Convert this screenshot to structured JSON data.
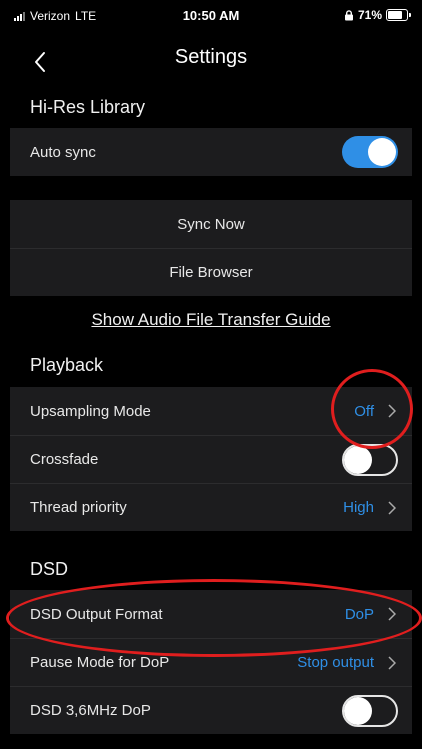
{
  "status_bar": {
    "carrier": "Verizon",
    "network": "LTE",
    "time": "10:50 AM",
    "battery": "71%"
  },
  "nav": {
    "title": "Settings",
    "back_icon": "chevron-left-icon"
  },
  "hires_library": {
    "header": "Hi-Res Library",
    "auto_sync": {
      "label": "Auto sync",
      "enabled": true
    },
    "sync_now_label": "Sync Now",
    "file_browser_label": "File Browser",
    "transfer_guide_link": "Show Audio File Transfer Guide"
  },
  "playback": {
    "header": "Playback",
    "rows": [
      {
        "label": "Upsampling Mode",
        "value": "Off"
      },
      {
        "label": "Crossfade",
        "toggle": false
      },
      {
        "label": "Thread priority",
        "value": "High"
      }
    ]
  },
  "dsd": {
    "header": "DSD",
    "rows": [
      {
        "label": "DSD Output Format",
        "value": "DoP"
      },
      {
        "label": "Pause Mode for DoP",
        "value": "Stop output"
      },
      {
        "label": "DSD 3,6MHz DoP",
        "toggle": false
      }
    ]
  },
  "colors": {
    "accent": "#2f8fe6",
    "annotation": "#e01e1e",
    "row_bg": "#1c1c1e"
  }
}
